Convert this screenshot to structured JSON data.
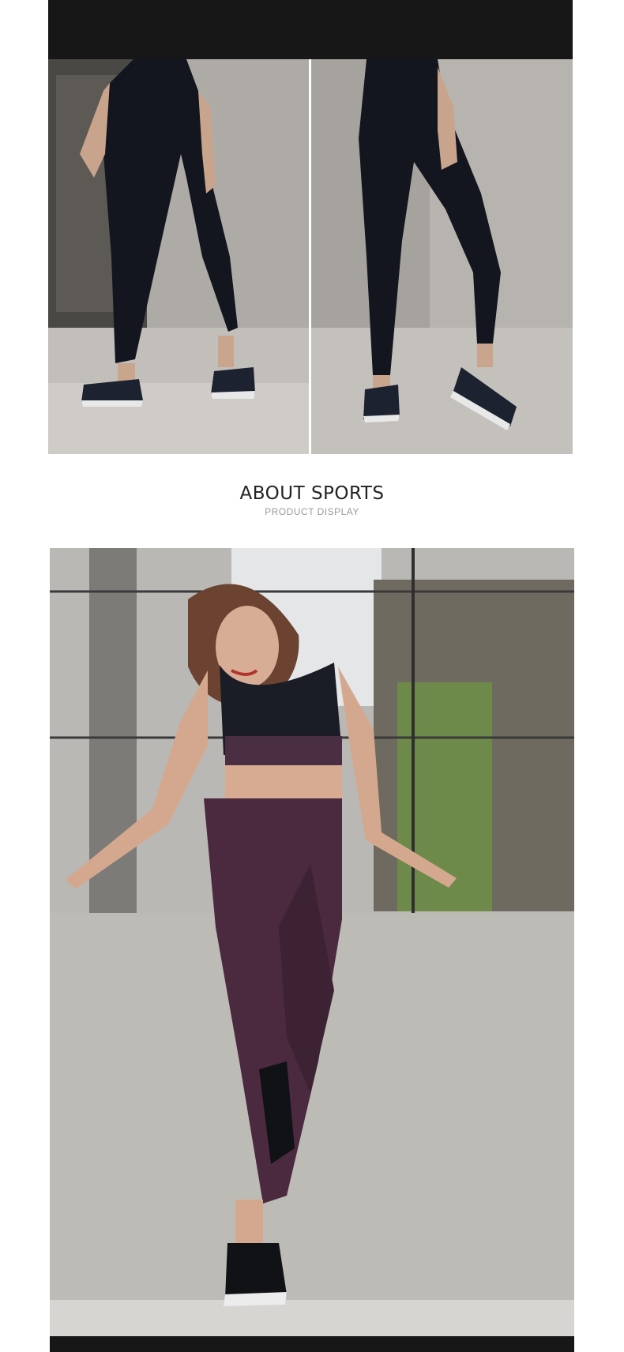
{
  "section": {
    "title": "ABOUT SPORTS",
    "subtitle": "PRODUCT DISPLAY"
  },
  "photos": {
    "back_view": "black-leggings-back-photo",
    "front_view": "black-leggings-front-photo",
    "hero": "purple-leggings-model-photo"
  },
  "colors": {
    "band": "#171717",
    "concrete": "#b9b7b3",
    "leggings_black": "#13161f",
    "leggings_purple": "#4b2a3f"
  }
}
